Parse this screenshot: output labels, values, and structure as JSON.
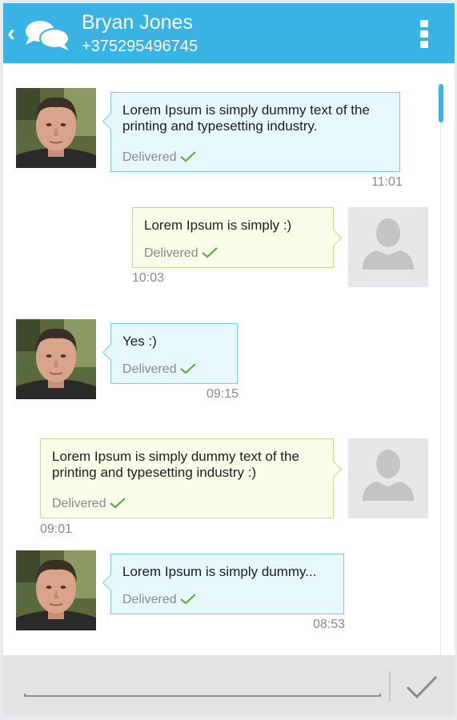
{
  "header": {
    "contact_name": "Bryan Jones",
    "contact_phone": "+375295496745",
    "back_icon": "chevron-left-icon",
    "chat_icon": "chat-bubbles-icon",
    "menu_icon": "overflow-menu-icon",
    "background_color": "#38b3e3"
  },
  "messages": [
    {
      "direction": "incoming",
      "lines": [
        "Lorem Ipsum is simply dummy text of the",
        "printing and typesetting industry."
      ],
      "status": "Delivered",
      "time": "11:01"
    },
    {
      "direction": "outgoing",
      "lines": [
        "Lorem Ipsum is simply :)"
      ],
      "status": "Delivered",
      "time": "10:03"
    },
    {
      "direction": "incoming",
      "lines": [
        "Yes :)"
      ],
      "status": "Delivered",
      "time": "09:15"
    },
    {
      "direction": "outgoing",
      "lines": [
        "Lorem Ipsum is simply dummy text of the",
        "printing and typesetting industry :)"
      ],
      "status": "Delivered",
      "time": "09:01"
    },
    {
      "direction": "incoming",
      "lines": [
        "Lorem Ipsum is simply dummy..."
      ],
      "status": "Delivered",
      "time": "08:53"
    }
  ],
  "composer": {
    "input_value": "",
    "send_icon": "checkmark-send-icon"
  },
  "colors": {
    "incoming_bubble": "#e6f7fe",
    "incoming_border": "#7ccbed",
    "outgoing_bubble": "#fafde7",
    "outgoing_border": "#c5db94",
    "delivered_check": "#5aa832"
  }
}
